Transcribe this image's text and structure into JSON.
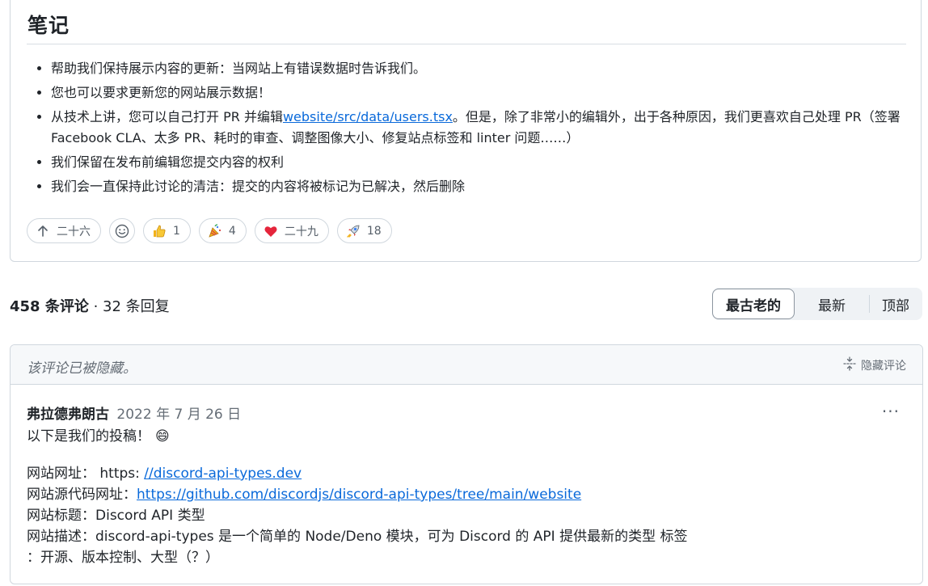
{
  "notes": {
    "title": "笔记",
    "items": [
      {
        "text": "帮助我们保持展示内容的更新：当网站上有错误数据时告诉我们。"
      },
      {
        "text": "您也可以要求更新您的网站展示数据！"
      },
      {
        "before": "从技术上讲，您可以自己打开 PR 并编辑",
        "link": "website/src/data/users.tsx",
        "after": "。但是，除了非常小的编辑外，出于各种原因，我们更喜欢自己处理 PR（签署 Facebook CLA、太多 PR、耗时的审查、调整图像大小、修复站点标签和 linter 问题……）"
      },
      {
        "text": "我们保留在发布前编辑您提交内容的权利"
      },
      {
        "text": "我们会一直保持此讨论的清洁：提交的内容将被标记为已解决，然后删除"
      }
    ]
  },
  "reactions": {
    "upvote": {
      "icon": "arrow-up-icon",
      "count": "二十六"
    },
    "add": {
      "icon": "smiley-icon"
    },
    "thumbs_up": {
      "icon": "thumbs-up-icon",
      "count": "1"
    },
    "tada": {
      "icon": "party-popper-icon",
      "count": "4"
    },
    "heart": {
      "icon": "heart-icon",
      "count": "二十九"
    },
    "rocket": {
      "icon": "rocket-icon",
      "count": "18"
    }
  },
  "comments_header": {
    "count": "458 条评论",
    "separator": " · ",
    "replies": "32 条回复",
    "sort": {
      "oldest": "最古老的",
      "newest": "最新",
      "top": "顶部",
      "selected": "最古老的"
    }
  },
  "comment": {
    "hidden_notice": "该评论已被隐藏。",
    "hide_label": "隐藏评论",
    "author": "弗拉德弗朗古",
    "date": "2022 年 7 月 26 日",
    "more": "···",
    "intro": "以下是我们的投稿！",
    "emoji": "😄",
    "site_label": "网站网址：",
    "site_prefix": " https: ",
    "site_link": "//discord-api-types.dev",
    "source_label": "网站源代码网址：",
    "source_link": "https://github.com/discordjs/discord-api-types/tree/main/website",
    "title_line": "网站标题：Discord API 类型",
    "desc_line": "网站描述：discord-api-types 是一个简单的 Node/Deno 模块，可为 Discord 的 API 提供最新的类型 标签",
    "tags_line": "：开源、版本控制、大型（？）"
  }
}
